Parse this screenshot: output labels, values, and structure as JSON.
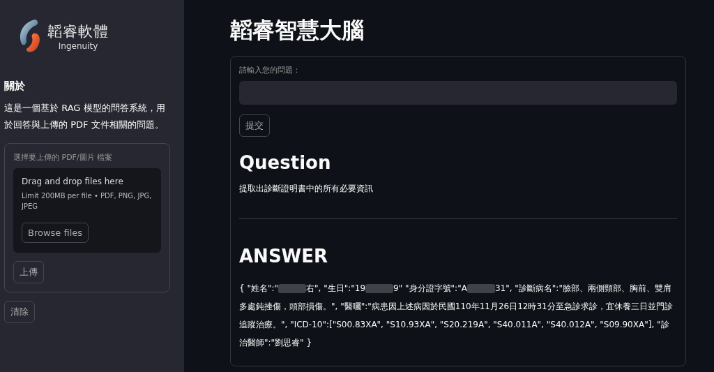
{
  "sidebar": {
    "logo": {
      "name": "韜睿軟體",
      "subtitle": "Ingenuity"
    },
    "about": {
      "heading": "關於",
      "text": "這是一個基於 RAG 模型的問答系統，用於回答與上傳的 PDF 文件相關的問題。"
    },
    "uploader": {
      "label": "選擇要上傳的 PDF/圖片 檔案",
      "drop_title": "Drag and drop files here",
      "drop_hint": "Limit 200MB per file • PDF, PNG, JPG, JPEG",
      "browse_button": "Browse files",
      "upload_button": "上傳"
    },
    "clear_button": "清除"
  },
  "main": {
    "title": "韜睿智慧大腦",
    "question_field": {
      "label": "請輸入您的問題："
    },
    "submit_button": "提交",
    "question_heading": "Question",
    "question_text": "提取出診斷證明書中的所有必要資訊",
    "answer_heading": "ANSWER",
    "answer_parts": [
      {
        "kind": "text",
        "text": "{ \"姓名\":\""
      },
      {
        "kind": "redacted"
      },
      {
        "kind": "text",
        "text": "右\", \"生日\":\"19"
      },
      {
        "kind": "redacted"
      },
      {
        "kind": "text",
        "text": "9\" \"身分證字號\":\"A"
      },
      {
        "kind": "redacted"
      },
      {
        "kind": "text",
        "text": "31\", \"診斷病名\":\"臉部、兩側頸部、胸前、雙肩多處鈍挫傷，頭部損傷。\", \"醫囑\":\"病患因上述病因於民國110年11月26日12時31分至急診求診，宜休養三日並門診追蹤治療。\", \"ICD-10\":[\"S00.83XA\", \"S10.93XA\", \"S20.219A\", \"S40.011A\", \"S40.012A\", \"S09.90XA\"], \"診治醫師\":\"劉思睿\" }"
      }
    ]
  }
}
